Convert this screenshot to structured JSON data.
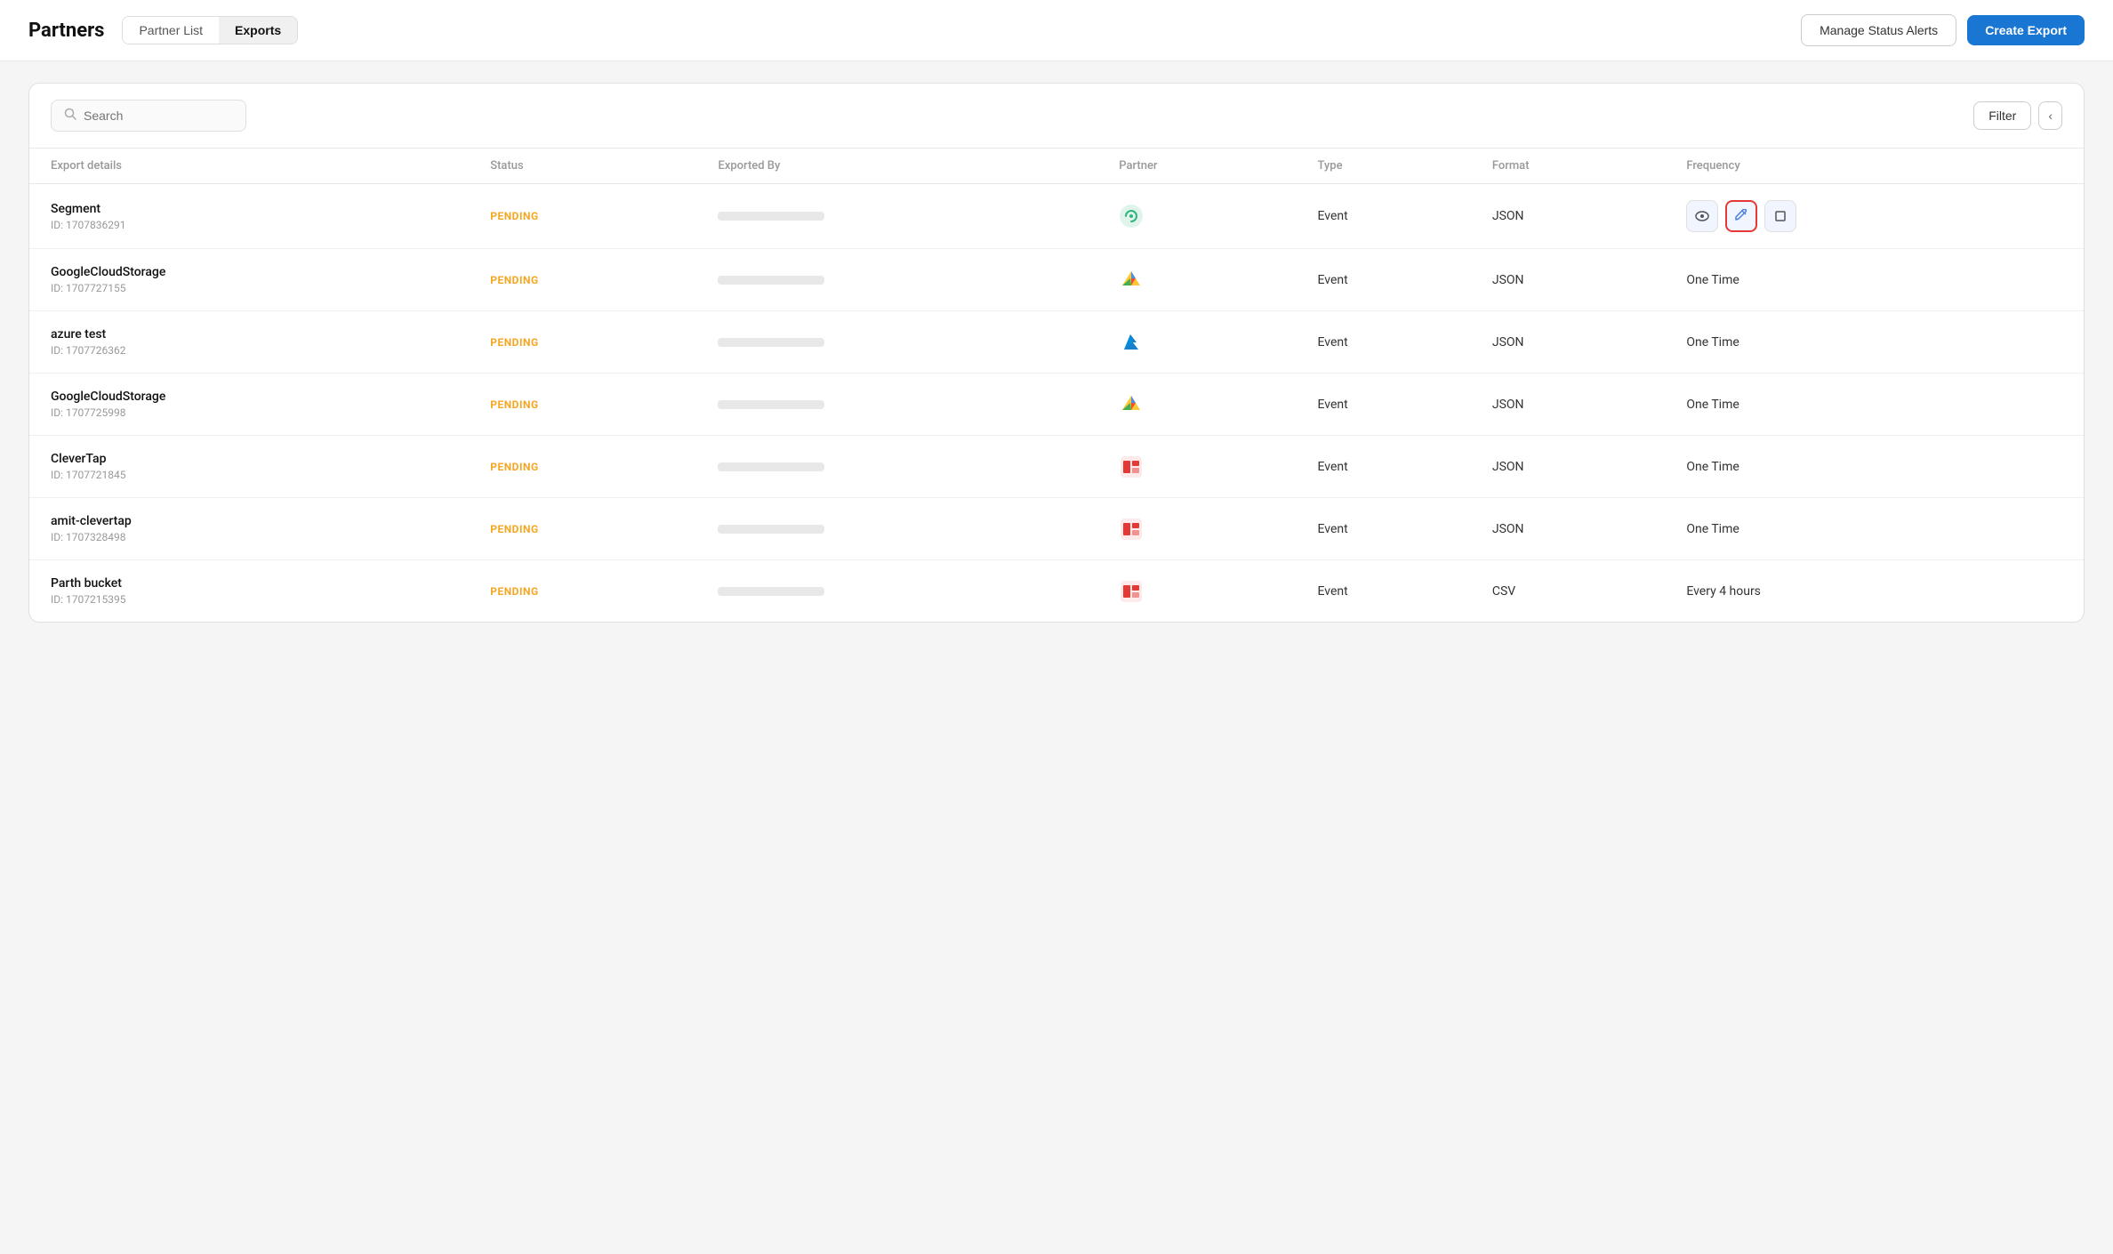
{
  "header": {
    "title": "Partners",
    "tabs": [
      {
        "id": "partner-list",
        "label": "Partner List",
        "active": false
      },
      {
        "id": "exports",
        "label": "Exports",
        "active": true
      }
    ],
    "manageBtn": "Manage Status Alerts",
    "createBtn": "Create Export"
  },
  "toolbar": {
    "searchPlaceholder": "Search",
    "filterBtn": "Filter",
    "collapseBtn": "‹"
  },
  "table": {
    "columns": [
      {
        "id": "export-details",
        "label": "Export details"
      },
      {
        "id": "status",
        "label": "Status"
      },
      {
        "id": "exported-by",
        "label": "Exported By"
      },
      {
        "id": "partner",
        "label": "Partner"
      },
      {
        "id": "type",
        "label": "Type"
      },
      {
        "id": "format",
        "label": "Format"
      },
      {
        "id": "frequency",
        "label": "Frequency"
      }
    ],
    "rows": [
      {
        "name": "Segment",
        "id": "ID: 1707836291",
        "status": "PENDING",
        "partner": "segment",
        "type": "Event",
        "format": "JSON",
        "frequency": "",
        "highlighted": true
      },
      {
        "name": "GoogleCloudStorage",
        "id": "ID: 1707727155",
        "status": "PENDING",
        "partner": "gcs",
        "type": "Event",
        "format": "JSON",
        "frequency": "One Time",
        "highlighted": false
      },
      {
        "name": "azure test",
        "id": "ID: 1707726362",
        "status": "PENDING",
        "partner": "azure",
        "type": "Event",
        "format": "JSON",
        "frequency": "One Time",
        "highlighted": false
      },
      {
        "name": "GoogleCloudStorage",
        "id": "ID: 1707725998",
        "status": "PENDING",
        "partner": "gcs",
        "type": "Event",
        "format": "JSON",
        "frequency": "One Time",
        "highlighted": false
      },
      {
        "name": "CleverTap",
        "id": "ID: 1707721845",
        "status": "PENDING",
        "partner": "clevertap",
        "type": "Event",
        "format": "JSON",
        "frequency": "One Time",
        "highlighted": false
      },
      {
        "name": "amit-clevertap",
        "id": "ID: 1707328498",
        "status": "PENDING",
        "partner": "clevertap",
        "type": "Event",
        "format": "JSON",
        "frequency": "One Time",
        "highlighted": false
      },
      {
        "name": "Parth bucket",
        "id": "ID: 1707215395",
        "status": "PENDING",
        "partner": "clevertap",
        "type": "Event",
        "format": "CSV",
        "frequency": "Every 4 hours",
        "highlighted": false
      }
    ]
  }
}
